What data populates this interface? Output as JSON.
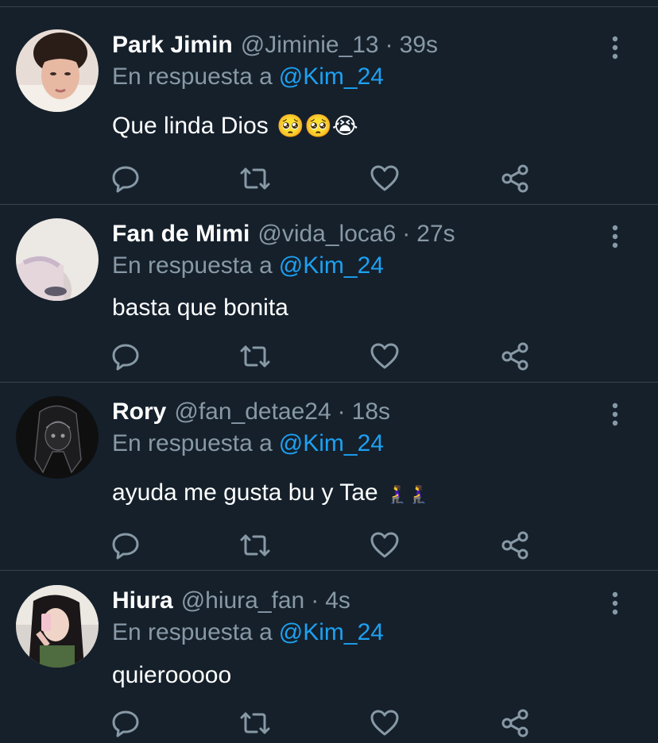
{
  "theme": {
    "background": "#15202b",
    "separator": "#38444d",
    "text_primary": "#ffffff",
    "text_secondary": "#8899a6",
    "link": "#1da1f2"
  },
  "reply_prefix": "En respuesta a",
  "tweets": [
    {
      "display_name": "Park Jimin",
      "handle": "@Jiminie_13",
      "time": "39s",
      "reply_to": "@Kim_24",
      "text": "Que linda Dios",
      "emoji": "🥺🥺😭",
      "avatar_icon": "avatar-photo-icon"
    },
    {
      "display_name": "Fan de Mimi",
      "handle": "@vida_loca6",
      "time": "27s",
      "reply_to": "@Kim_24",
      "text": "basta que bonita",
      "emoji": "",
      "avatar_icon": "avatar-photo-icon"
    },
    {
      "display_name": "Rory",
      "handle": "@fan_detae24",
      "time": "18s",
      "reply_to": "@Kim_24",
      "text": "ayuda me gusta bu y Tae",
      "emoji": "🧎‍♀️🧎‍♀️",
      "avatar_icon": "avatar-drawing-icon"
    },
    {
      "display_name": "Hiura",
      "handle": "@hiura_fan",
      "time": "4s",
      "reply_to": "@Kim_24",
      "text": "quierooooo",
      "emoji": "",
      "avatar_icon": "avatar-photo-icon"
    }
  ],
  "actions": [
    "reply-icon",
    "retweet-icon",
    "like-icon",
    "share-icon"
  ],
  "more_icon": "more-options-icon"
}
